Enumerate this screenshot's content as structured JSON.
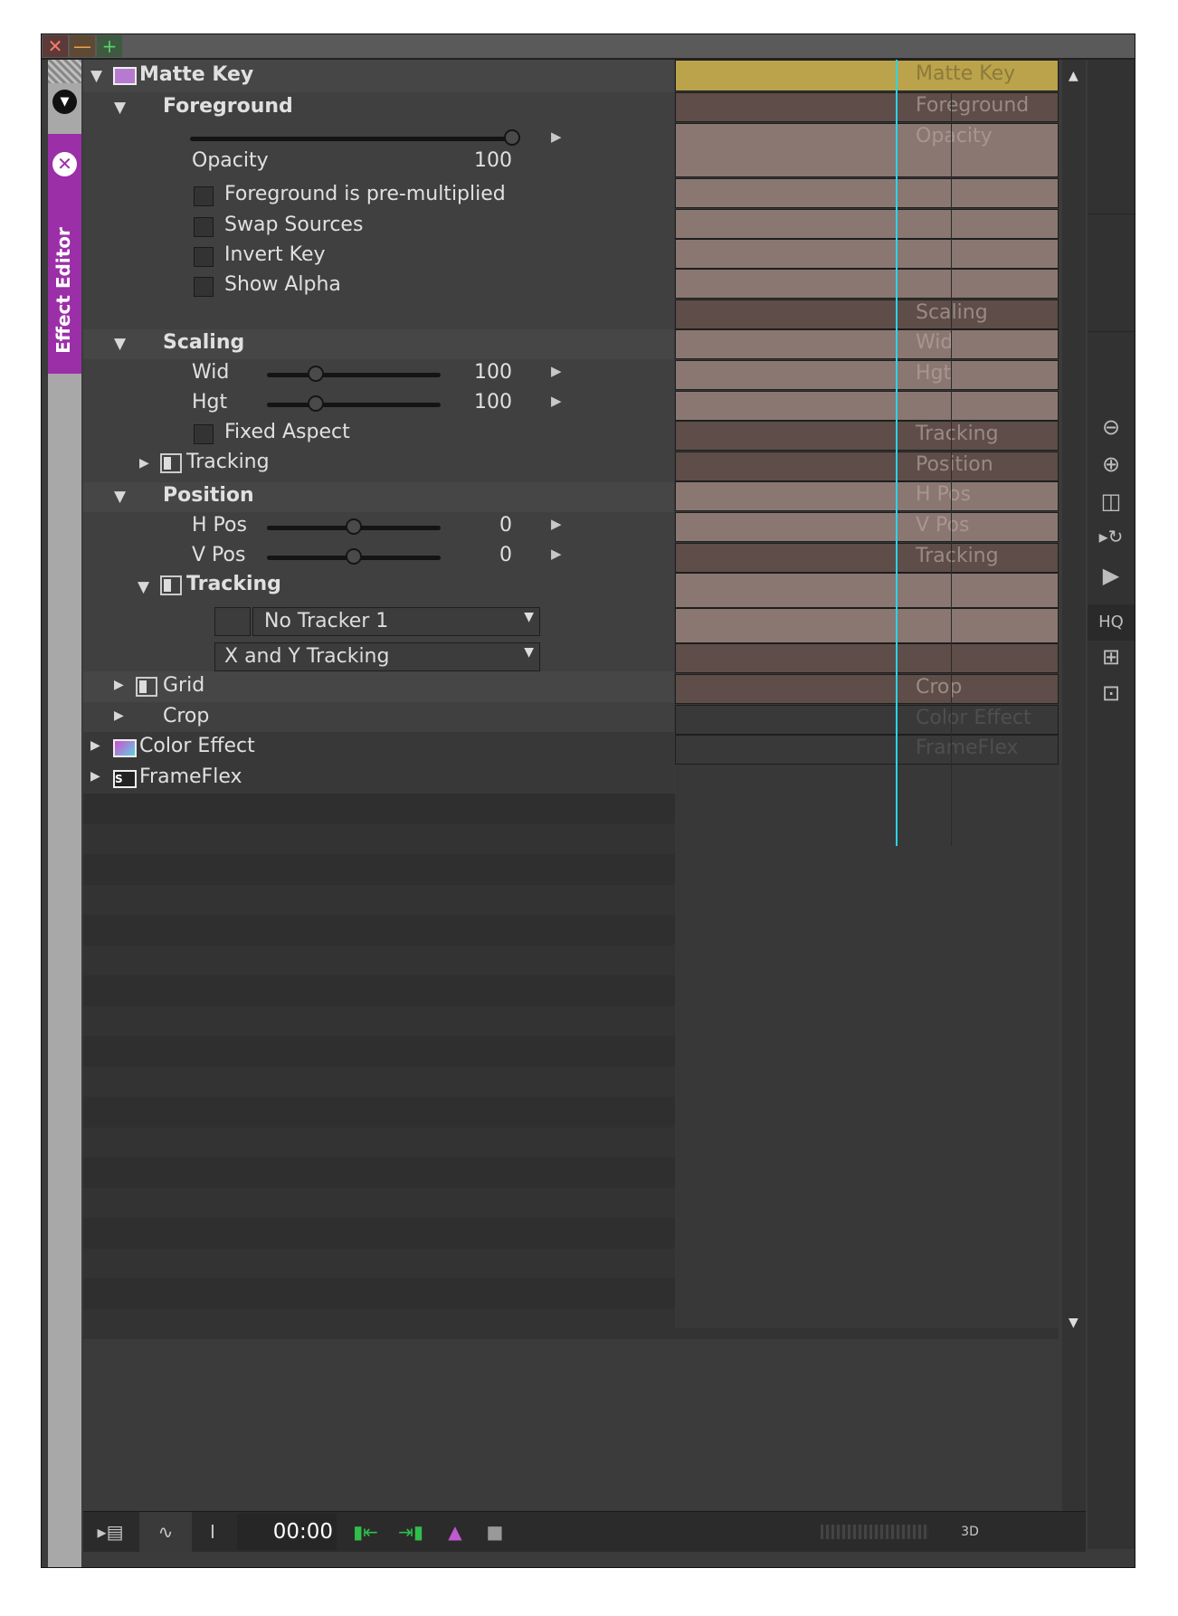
{
  "window": {
    "title_buttons": {
      "close": "✕",
      "minimize": "—",
      "add": "+"
    },
    "side_tab": {
      "label": "Effect Editor",
      "close_glyph": "✕",
      "dropdown_glyph": "▼"
    }
  },
  "params": {
    "matte_key": {
      "label": "Matte Key",
      "icon": "matte-key-icon"
    },
    "foreground": {
      "label": "Foreground"
    },
    "opacity": {
      "label": "Opacity",
      "value": "100",
      "level": 1.0
    },
    "checks": [
      {
        "label": "Foreground is pre-multiplied",
        "checked": false
      },
      {
        "label": "Swap Sources",
        "checked": false
      },
      {
        "label": "Invert Key",
        "checked": false
      },
      {
        "label": "Show Alpha",
        "checked": false
      }
    ],
    "scaling": {
      "label": "Scaling"
    },
    "wid": {
      "label": "Wid",
      "value": "100",
      "level": 0.28
    },
    "hgt": {
      "label": "Hgt",
      "value": "100",
      "level": 0.28
    },
    "fixed_aspect": {
      "label": "Fixed Aspect",
      "checked": false
    },
    "tracking1": {
      "label": "Tracking"
    },
    "position": {
      "label": "Position"
    },
    "hpos": {
      "label": "H Pos",
      "value": "0",
      "level": 0.5
    },
    "vpos": {
      "label": "V Pos",
      "value": "0",
      "level": 0.5
    },
    "tracking2": {
      "label": "Tracking"
    },
    "tracker_select": "No Tracker 1",
    "tracking_mode_select": "X and Y Tracking",
    "grid": {
      "label": "Grid"
    },
    "crop": {
      "label": "Crop"
    },
    "color_effect": {
      "label": "Color Effect",
      "icon": "color-effect-icon"
    },
    "frameflex": {
      "label": "FrameFlex",
      "icon": "frameflex-icon"
    }
  },
  "timeline": {
    "tracks": [
      "Matte Key",
      "Foreground",
      "Opacity",
      "",
      "",
      "",
      "",
      "Scaling",
      "Wid",
      "Hgt",
      "",
      "Tracking",
      "Position",
      "H Pos",
      "V Pos",
      "Tracking",
      "",
      "",
      "",
      "Crop",
      "Color Effect",
      "FrameFlex"
    ],
    "colors": {
      "matte_key": "#bba34c",
      "group": "#5e4d48",
      "param": "#8a7772",
      "effect": "#393939",
      "playhead": "#2ad4e6"
    }
  },
  "toolbar_right": {
    "zoom_out": "zoom-out-icon",
    "zoom_in": "zoom-in-icon",
    "split_view": "split-view-icon",
    "play_loop": "play-loop-icon",
    "play": "play-icon",
    "hq_label": "HQ",
    "safe_area": "safe-area-icon",
    "fit": "fit-icon"
  },
  "bottom": {
    "timecode": "00:00",
    "render_label": "3D"
  }
}
